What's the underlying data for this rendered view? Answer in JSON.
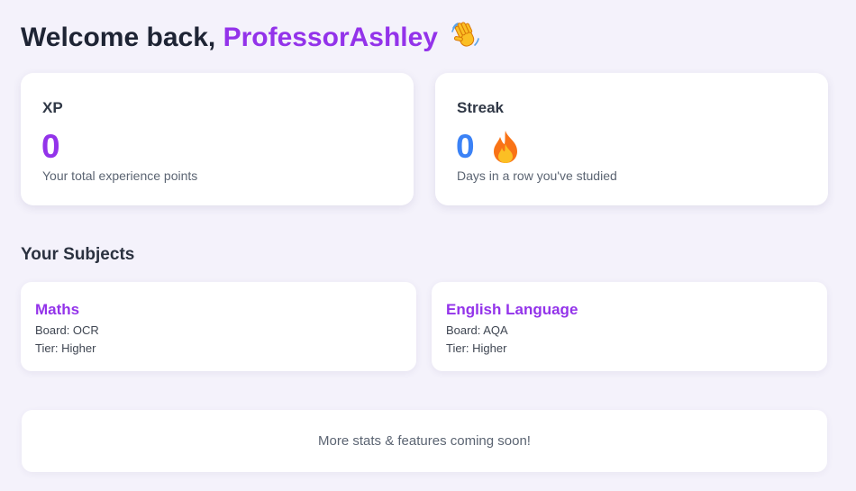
{
  "header": {
    "greeting": "Welcome back,",
    "username": "ProfessorAshley",
    "icon": "waving-hand-icon"
  },
  "stats": {
    "xp": {
      "title": "XP",
      "value": "0",
      "description": "Your total experience points",
      "color": "#9333ea"
    },
    "streak": {
      "title": "Streak",
      "value": "0",
      "description": "Days in a row you've studied",
      "icon": "fire-icon",
      "color": "#3b82f6"
    }
  },
  "subjects": {
    "title": "Your Subjects",
    "items": [
      {
        "name": "Maths",
        "board": "Board: OCR",
        "tier": "Tier: Higher"
      },
      {
        "name": "English Language",
        "board": "Board: AQA",
        "tier": "Tier: Higher"
      }
    ]
  },
  "footer": {
    "message": "More stats & features coming soon!"
  },
  "colors": {
    "accent": "#9333ea",
    "streak": "#3b82f6",
    "background": "#f4f2fb"
  }
}
